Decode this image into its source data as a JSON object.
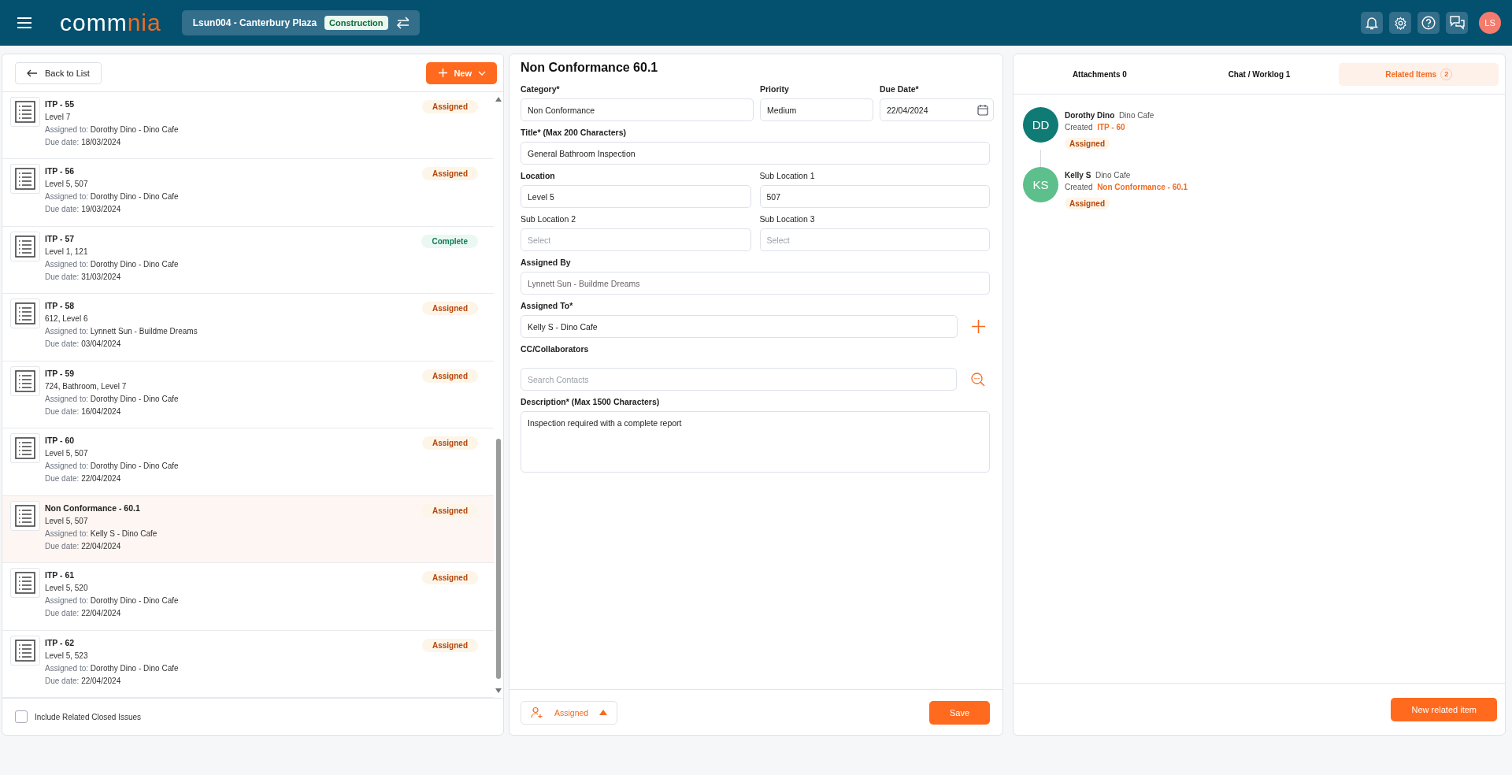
{
  "header": {
    "logo": [
      "comm",
      "nia"
    ],
    "project": {
      "name": "Lsun004 - Canterbury Plaza",
      "tag": "Construction"
    },
    "user_initials": "LS"
  },
  "list_panel": {
    "back_label": "Back to List",
    "new_label": "New",
    "items": [
      {
        "title": "ITP - 55",
        "location": "Level 7",
        "assigned_label": "Assigned to:",
        "assignee": "Dorothy Dino - Dino Cafe",
        "due_label": "Due date:",
        "due": "18/03/2024",
        "status": {
          "label": "Assigned",
          "kind": "assigned"
        },
        "selected": false
      },
      {
        "title": "ITP - 56",
        "location": "Level 5, 507",
        "assigned_label": "Assigned to:",
        "assignee": "Dorothy Dino - Dino Cafe",
        "due_label": "Due date:",
        "due": "19/03/2024",
        "status": {
          "label": "Assigned",
          "kind": "assigned"
        },
        "selected": false
      },
      {
        "title": "ITP - 57",
        "location": "Level 1, 121",
        "assigned_label": "Assigned to:",
        "assignee": "Dorothy Dino - Dino Cafe",
        "due_label": "Due date:",
        "due": "31/03/2024",
        "status": {
          "label": "Complete",
          "kind": "complete"
        },
        "selected": false
      },
      {
        "title": "ITP - 58",
        "location": "612, Level 6",
        "assigned_label": "Assigned to:",
        "assignee": "Lynnett Sun - Buildme Dreams",
        "due_label": "Due date:",
        "due": "03/04/2024",
        "status": {
          "label": "Assigned",
          "kind": "assigned"
        },
        "selected": false
      },
      {
        "title": "ITP - 59",
        "location": "724, Bathroom, Level 7",
        "assigned_label": "Assigned to:",
        "assignee": "Dorothy Dino - Dino Cafe",
        "due_label": "Due date:",
        "due": "16/04/2024",
        "status": {
          "label": "Assigned",
          "kind": "assigned"
        },
        "selected": false
      },
      {
        "title": "ITP - 60",
        "location": "Level 5, 507",
        "assigned_label": "Assigned to:",
        "assignee": "Dorothy Dino - Dino Cafe",
        "due_label": "Due date:",
        "due": "22/04/2024",
        "status": {
          "label": "Assigned",
          "kind": "assigned"
        },
        "selected": false
      },
      {
        "title": "Non Conformance - 60.1",
        "location": "Level 5, 507",
        "assigned_label": "Assigned to:",
        "assignee": "Kelly S - Dino Cafe",
        "due_label": "Due date:",
        "due": "22/04/2024",
        "status": {
          "label": "Assigned",
          "kind": "assigned"
        },
        "selected": true
      },
      {
        "title": "ITP - 61",
        "location": "Level 5, 520",
        "assigned_label": "Assigned to:",
        "assignee": "Dorothy Dino - Dino Cafe",
        "due_label": "Due date:",
        "due": "22/04/2024",
        "status": {
          "label": "Assigned",
          "kind": "assigned"
        },
        "selected": false
      },
      {
        "title": "ITP - 62",
        "location": "Level 5, 523",
        "assigned_label": "Assigned to:",
        "assignee": "Dorothy Dino - Dino Cafe",
        "due_label": "Due date:",
        "due": "22/04/2024",
        "status": {
          "label": "Assigned",
          "kind": "assigned"
        },
        "selected": false
      }
    ],
    "include_closed": {
      "label": "Include Related Closed Issues",
      "checked": false
    }
  },
  "form": {
    "title": "Non Conformance 60.1",
    "category": {
      "label": "Category*",
      "value": "Non Conformance"
    },
    "priority": {
      "label": "Priority",
      "value": "Medium"
    },
    "due_date": {
      "label": "Due Date*",
      "value": "22/04/2024"
    },
    "title_field": {
      "label": "Title* (Max 200 Characters)",
      "value": "General Bathroom Inspection"
    },
    "location": {
      "label": "Location",
      "value": "Level 5"
    },
    "sub_location_1": {
      "label": "Sub Location 1",
      "value": "507"
    },
    "sub_location_2": {
      "label": "Sub Location 2",
      "placeholder": "Select"
    },
    "sub_location_3": {
      "label": "Sub Location 3",
      "placeholder": "Select"
    },
    "assigned_by": {
      "label": "Assigned By",
      "value": "Lynnett Sun - Buildme Dreams"
    },
    "assigned_to": {
      "label": "Assigned To*",
      "value": "Kelly S - Dino Cafe"
    },
    "cc": {
      "label": "CC/Collaborators",
      "placeholder": "Search Contacts"
    },
    "description": {
      "label": "Description* (Max 1500 Characters)",
      "value": "Inspection required with a complete report"
    },
    "status_button": "Assigned",
    "save_label": "Save"
  },
  "side_panel": {
    "tabs": [
      {
        "label": "Attachments 0",
        "selected": false
      },
      {
        "label": "Chat / Worklog 1",
        "selected": false
      },
      {
        "label": "Related Items",
        "count": "2",
        "selected": true
      }
    ],
    "related": [
      {
        "initials": "DD",
        "color": "#0f7b74",
        "name": "Dorothy Dino",
        "company": "Dino Cafe",
        "action": "Created",
        "item": "ITP - 60",
        "status": "Assigned"
      },
      {
        "initials": "KS",
        "color": "#5dbf8b",
        "name": "Kelly S",
        "company": "Dino Cafe",
        "action": "Created",
        "item": "Non Conformance - 60.1",
        "status": "Assigned"
      }
    ],
    "new_label": "New related item"
  }
}
